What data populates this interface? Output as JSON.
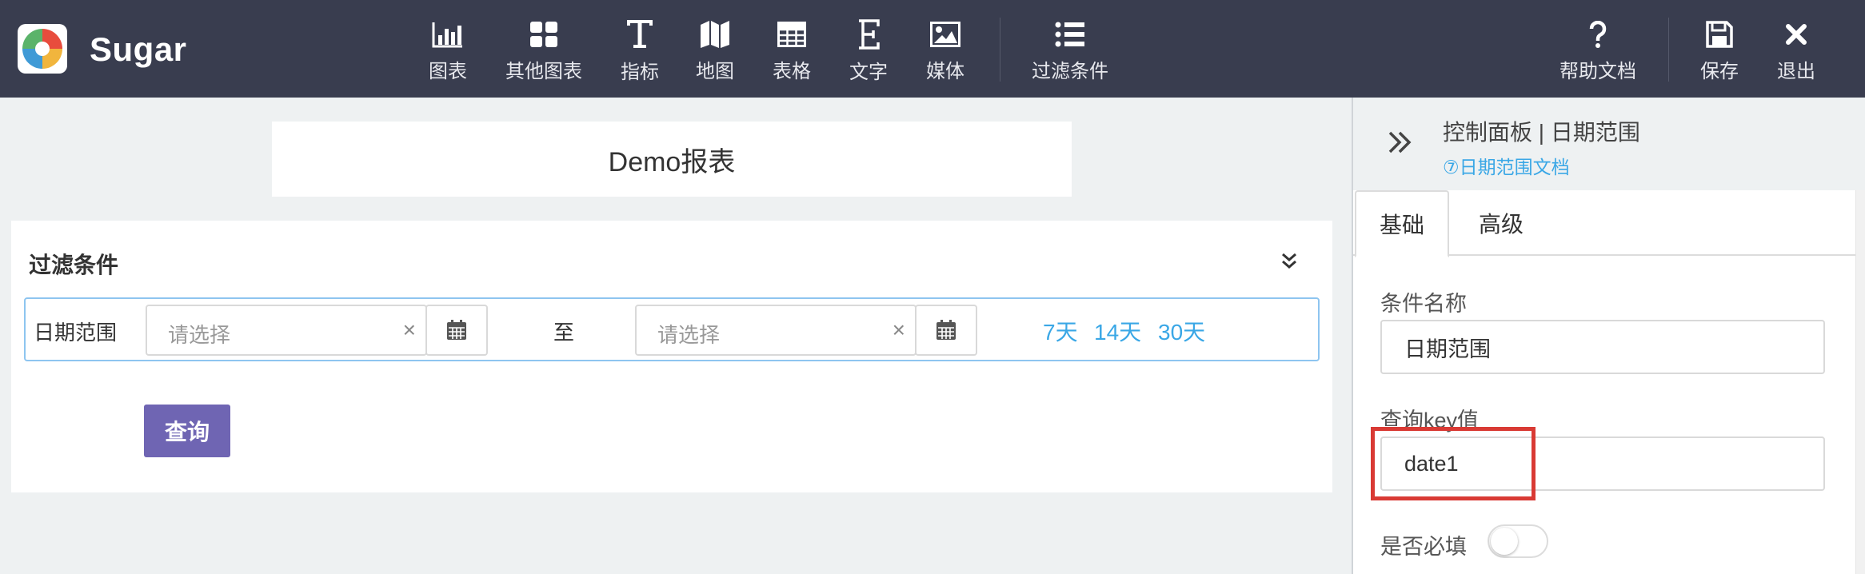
{
  "app": {
    "name": "Sugar"
  },
  "toolbar": {
    "items": [
      {
        "label": "图表",
        "icon": "bar-chart-icon"
      },
      {
        "label": "其他图表",
        "icon": "grid-icon"
      },
      {
        "label": "指标",
        "icon": "text-t-icon"
      },
      {
        "label": "地图",
        "icon": "map-icon"
      },
      {
        "label": "表格",
        "icon": "table-icon"
      },
      {
        "label": "文字",
        "icon": "text-e-icon"
      },
      {
        "label": "媒体",
        "icon": "image-icon"
      },
      {
        "label": "过滤条件",
        "icon": "list-icon"
      }
    ],
    "help": {
      "label": "帮助文档",
      "icon": "question-icon"
    },
    "save": {
      "label": "保存",
      "icon": "floppy-icon"
    },
    "exit": {
      "label": "退出",
      "icon": "close-icon"
    }
  },
  "report": {
    "title": "Demo报表"
  },
  "filter": {
    "title": "过滤条件",
    "row_label": "日期范围",
    "start_placeholder": "请选择",
    "end_placeholder": "请选择",
    "separator": "至",
    "clear_glyph": "×",
    "quick_ranges": [
      "7天",
      "14天",
      "30天"
    ],
    "query_button": "查询"
  },
  "panel": {
    "title": "控制面板 | 日期范围",
    "doc_link": "⑦日期范围文档",
    "tabs": [
      "基础",
      "高级"
    ],
    "active_tab": "基础",
    "fields": {
      "name_label": "条件名称",
      "name_value": "日期范围",
      "key_label": "查询key值",
      "key_value": "date1",
      "required_label": "是否必填",
      "required_on": false
    }
  },
  "colors": {
    "topbar": "#393d4f",
    "accent_link": "#3aa7e6",
    "primary_button": "#6f65b3",
    "highlight_box": "#d93a34"
  }
}
